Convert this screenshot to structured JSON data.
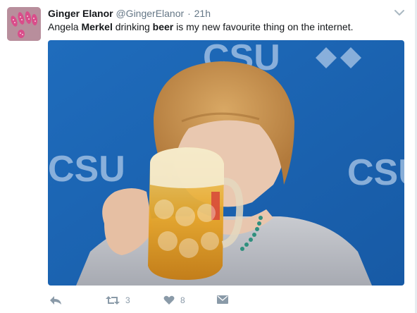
{
  "tweet": {
    "author_name": "Ginger Elanor",
    "handle": "@GingerElanor",
    "separator": "·",
    "time": "21h",
    "text_parts": [
      "Angela ",
      "Merkel",
      " drinking ",
      "beer",
      " is my new favourite thing on the internet."
    ],
    "photo_banner_text": [
      "CSU",
      "CSU",
      "CSU"
    ]
  },
  "actions": {
    "retweet_count": "3",
    "like_count": "8"
  },
  "colors": {
    "text": "#14171a",
    "secondary": "#657786",
    "action_icon": "#8a9aa8",
    "photo_background": "#1a63b4"
  },
  "icons": [
    "more-chevron-icon",
    "reply-icon",
    "retweet-icon",
    "heart-icon",
    "direct-message-icon"
  ]
}
